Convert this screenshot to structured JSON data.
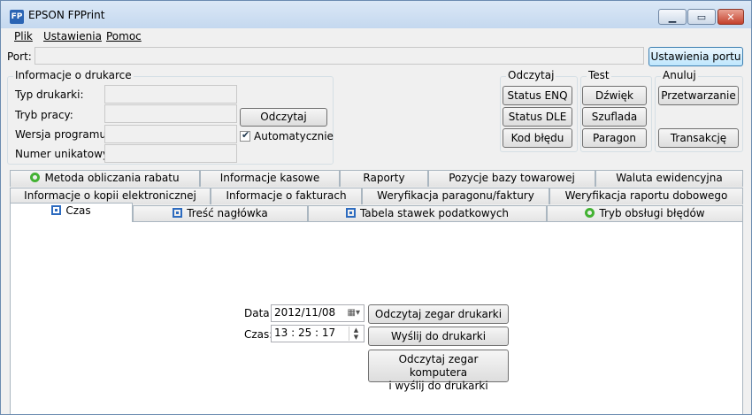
{
  "window": {
    "title": "EPSON FPPrint",
    "icon_text": "FP"
  },
  "menu": [
    "Plik",
    "Ustawienia",
    "Pomoc"
  ],
  "port": {
    "label": "Port:",
    "value": "",
    "settings_button": "Ustawienia portu"
  },
  "printer_info": {
    "title": "Informacje o drukarce",
    "fields": [
      {
        "label": "Typ drukarki:",
        "value": ""
      },
      {
        "label": "Tryb pracy:",
        "value": ""
      },
      {
        "label": "Wersja programu:",
        "value": ""
      },
      {
        "label": "Numer unikatowy:",
        "value": ""
      }
    ],
    "read_button": "Odczytaj",
    "auto_checkbox": {
      "label": "Automatycznie",
      "checked": true
    }
  },
  "read_group": {
    "title": "Odczytaj",
    "buttons": [
      "Status ENQ",
      "Status DLE",
      "Kod błędu"
    ]
  },
  "test_group": {
    "title": "Test",
    "buttons": [
      "Dźwięk",
      "Szuflada",
      "Paragon"
    ]
  },
  "cancel_group": {
    "title": "Anuluj",
    "buttons": [
      "Przetwarzanie",
      "Transakcję"
    ]
  },
  "tabs_row1": [
    {
      "label": "Metoda obliczania rabatu",
      "icon": "green-circle-icon"
    },
    {
      "label": "Informacje kasowe"
    },
    {
      "label": "Raporty"
    },
    {
      "label": "Pozycje bazy towarowej"
    },
    {
      "label": "Waluta ewidencyjna"
    }
  ],
  "tabs_row2": [
    {
      "label": "Informacje o kopii elektronicznej"
    },
    {
      "label": "Informacje o fakturach"
    },
    {
      "label": "Weryfikacja paragonu/faktury"
    },
    {
      "label": "Weryfikacja raportu dobowego"
    }
  ],
  "tabs_row3": [
    {
      "label": "Czas",
      "icon": "blue-square-icon",
      "active": true
    },
    {
      "label": "Treść nagłówka",
      "icon": "blue-square-icon"
    },
    {
      "label": "Tabela stawek podatkowych",
      "icon": "blue-square-icon"
    },
    {
      "label": "Tryb obsługi błędów",
      "icon": "green-circle-icon"
    }
  ],
  "time_panel": {
    "date_label": "Data:",
    "date_value": "2012/11/08",
    "time_label": "Czas:",
    "time_value": "13 : 25 : 17",
    "read_clock_button": "Odczytaj zegar drukarki",
    "send_button": "Wyślij do drukarki",
    "read_computer_button_line1": "Odczytaj zegar komputera",
    "read_computer_button_line2": "i wyślij do drukarki"
  },
  "colors": {
    "tab_icon_blue": "#2d6bbf",
    "tab_icon_green": "#43b233",
    "focus_border": "#3c7fb1"
  }
}
